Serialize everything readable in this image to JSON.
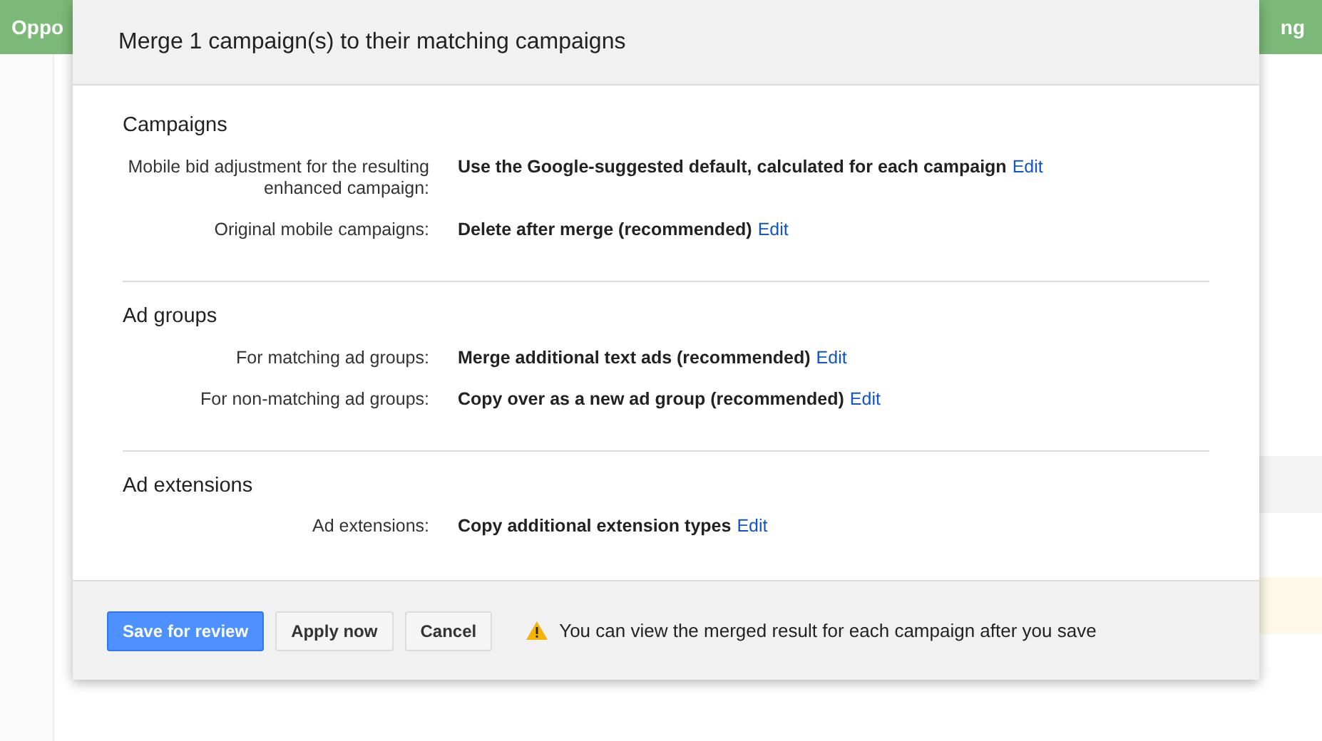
{
  "background": {
    "tab_left": "Oppo",
    "tab_right": "ng"
  },
  "dialog": {
    "title": "Merge 1 campaign(s) to their matching campaigns",
    "sections": [
      {
        "heading": "Campaigns",
        "rows": [
          {
            "label": "Mobile bid adjustment for the resulting enhanced campaign:",
            "value": "Use the Google-suggested default, calculated for each campaign",
            "link": "Edit"
          },
          {
            "label": "Original mobile campaigns:",
            "value": "Delete after merge (recommended)",
            "link": "Edit"
          }
        ]
      },
      {
        "heading": "Ad groups",
        "rows": [
          {
            "label": "For matching ad groups:",
            "value": "Merge additional text ads (recommended)",
            "link": "Edit"
          },
          {
            "label": "For non-matching ad groups:",
            "value": "Copy over as a new ad group (recommended)",
            "link": "Edit"
          }
        ]
      },
      {
        "heading": "Ad extensions",
        "rows": [
          {
            "label": "Ad extensions:",
            "value": "Copy additional extension types",
            "link": "Edit"
          }
        ]
      }
    ],
    "buttons": [
      {
        "label": "Save for review",
        "kind": "primary"
      },
      {
        "label": "Apply now",
        "kind": "secondary"
      },
      {
        "label": "Cancel",
        "kind": "secondary"
      }
    ],
    "notice": "You can view the merged result for each campaign after you save"
  }
}
